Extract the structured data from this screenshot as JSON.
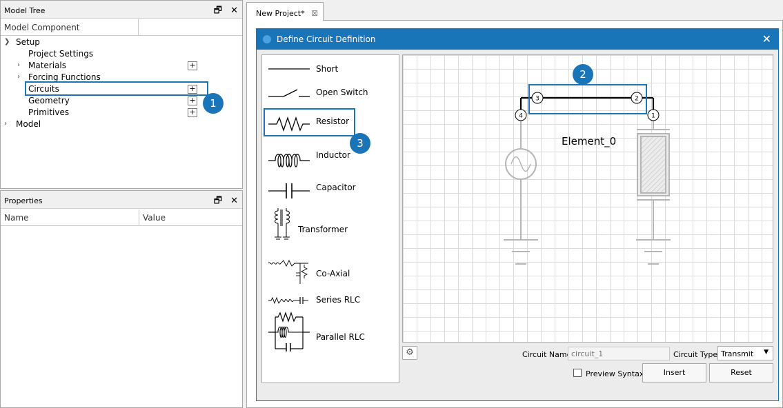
{
  "model_tree": {
    "title": "Model Tree",
    "column_header": "Model Component",
    "items": [
      {
        "label": "Setup",
        "expanded": true
      },
      {
        "label": "Project Settings"
      },
      {
        "label": "Materials"
      },
      {
        "label": "Forcing Functions"
      },
      {
        "label": "Circuits"
      },
      {
        "label": "Geometry"
      },
      {
        "label": "Primitives"
      },
      {
        "label": "Model"
      }
    ],
    "plus_label": "+"
  },
  "properties": {
    "title": "Properties",
    "columns": [
      "Name",
      "Value"
    ]
  },
  "panel_controls": {
    "float_icon": "🗗",
    "close_icon": "✕"
  },
  "tab": {
    "label": "New Project*",
    "close_icon": "⊠"
  },
  "dialog": {
    "title": "Define Circuit Definition",
    "close_icon": "✕",
    "palette": [
      "Short",
      "Open Switch",
      "Resistor",
      "Inductor",
      "Capacitor",
      "Transformer",
      "Co-Axial",
      "Series RLC",
      "Parallel RLC"
    ],
    "canvas": {
      "element_label": "Element_0",
      "nodes": [
        "4",
        "3",
        "2",
        "1"
      ]
    },
    "circuit_name_label": "Circuit Name:",
    "circuit_name_placeholder": "circuit_1",
    "circuit_type_label": "Circuit Type:",
    "circuit_type_value": "Transmit",
    "preview_syntax_label": "Preview Syntax",
    "insert_label": "Insert",
    "reset_label": "Reset",
    "gear_icon": "⚙"
  },
  "callouts": [
    "1",
    "2",
    "3"
  ],
  "colors": {
    "accent": "#1a74b8",
    "dialog_bg": "#ececec"
  }
}
